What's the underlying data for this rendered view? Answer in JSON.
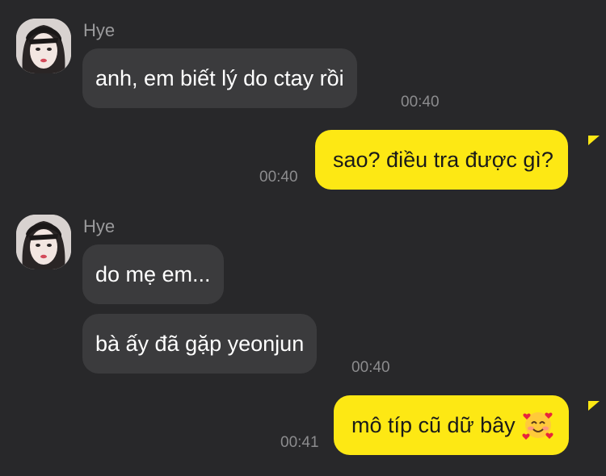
{
  "chat": {
    "messages": [
      {
        "sender": "Hye",
        "text": "anh, em biết lý do ctay rồi",
        "time": "00:40"
      },
      {
        "text": "sao? điều tra được gì?",
        "time": "00:40"
      },
      {
        "sender": "Hye",
        "text": "do mẹ em..."
      },
      {
        "text": "bà ấy đã gặp yeonjun",
        "time": "00:40"
      },
      {
        "text": "mô típ cũ dữ bây",
        "emoji": "smiling-face-with-hearts-icon",
        "time": "00:41"
      }
    ]
  },
  "colors": {
    "background": "#28282a",
    "incoming_bubble": "#3b3b3d",
    "outgoing_bubble": "#fde814"
  }
}
